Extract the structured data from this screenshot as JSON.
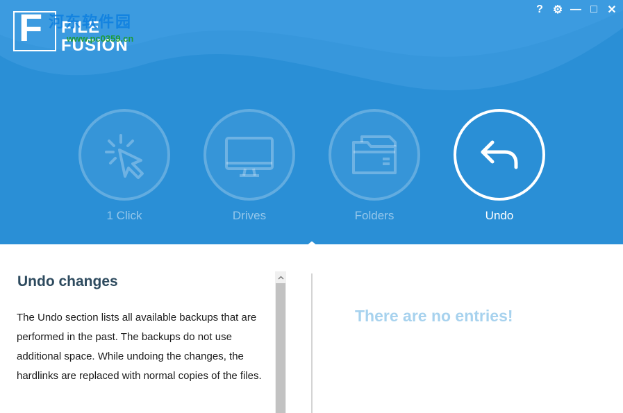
{
  "app": {
    "logo_letter": "F",
    "logo_line1": "FILE",
    "logo_line2": "FUSION",
    "watermark_text": "河东软件园",
    "watermark_url": "www.pc0359.cn"
  },
  "window_controls": {
    "help": "?",
    "settings": "⚙",
    "minimize": "—",
    "maximize": "□",
    "close": "✕"
  },
  "nav": {
    "items": [
      {
        "label": "1 Click",
        "icon": "cursor-click-icon",
        "active": false
      },
      {
        "label": "Drives",
        "icon": "monitor-icon",
        "active": false
      },
      {
        "label": "Folders",
        "icon": "folder-icon",
        "active": false
      },
      {
        "label": "Undo",
        "icon": "undo-arrow-icon",
        "active": true
      }
    ]
  },
  "info": {
    "title": "Undo changes",
    "text": "The Undo section lists all available backups that are performed in the past. The backups do not use additional space. While undoing the changes, the hardlinks are replaced with normal copies of the files."
  },
  "entries": {
    "empty_message": "There are no entries!"
  },
  "colors": {
    "header_bg": "#2a8fd6",
    "wave": "#3d9be0",
    "title_text": "#2d4a5e",
    "empty_text": "#a7d2ee"
  }
}
